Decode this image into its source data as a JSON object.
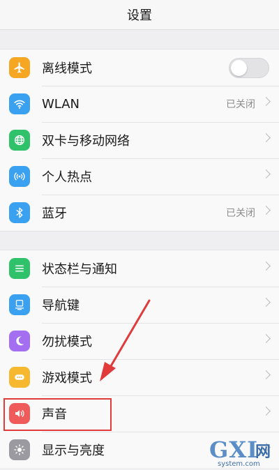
{
  "header": {
    "title": "设置"
  },
  "groups": [
    {
      "items": [
        {
          "label": "离线模式",
          "icon": "airplane-icon",
          "icon_color": "#f5a623",
          "control": "toggle",
          "toggle_on": false
        },
        {
          "label": "WLAN",
          "icon": "wifi-icon",
          "icon_color": "#3aa0f0",
          "value": "已关闭"
        },
        {
          "label": "双卡与移动网络",
          "icon": "globe-icon",
          "icon_color": "#2fc26b"
        },
        {
          "label": "个人热点",
          "icon": "hotspot-icon",
          "icon_color": "#3aa0f0"
        },
        {
          "label": "蓝牙",
          "icon": "bluetooth-icon",
          "icon_color": "#3aa0f0",
          "value": "已关闭"
        }
      ]
    },
    {
      "items": [
        {
          "label": "状态栏与通知",
          "icon": "status-bar-icon",
          "icon_color": "#2fc26b"
        },
        {
          "label": "导航键",
          "icon": "navigation-key-icon",
          "icon_color": "#3aa0f0"
        },
        {
          "label": "勿扰模式",
          "icon": "moon-icon",
          "icon_color": "#a36ef0"
        },
        {
          "label": "游戏模式",
          "icon": "gamepad-icon",
          "icon_color": "#f5b82e"
        },
        {
          "label": "声音",
          "icon": "speaker-icon",
          "icon_color": "#ef5a5a"
        },
        {
          "label": "显示与亮度",
          "icon": "brightness-icon",
          "icon_color": "#9a9aa0"
        }
      ]
    }
  ],
  "annotation": {
    "highlight_color": "#e03a3a",
    "highlighted_item": "声音"
  },
  "watermark": {
    "main": "GXI",
    "cn": "网",
    "url": "system.com"
  }
}
